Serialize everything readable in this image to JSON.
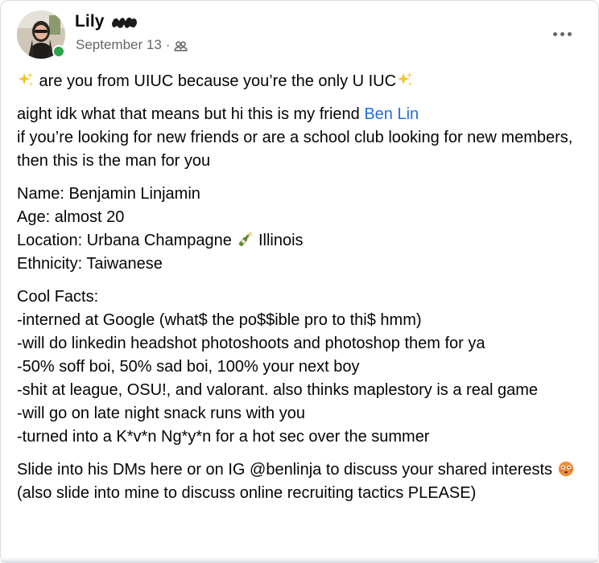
{
  "post": {
    "author": {
      "name": "Lily",
      "avatar_icon": "avatar-photo",
      "online": true,
      "online_color": "#31a24c"
    },
    "meta": {
      "date": "September 13",
      "separator": "·",
      "audience_icon": "friends-audience-icon"
    },
    "more_button": "more-options-icon",
    "text": {
      "line1_before": " are you from UIUC because you’re the only U  IUC",
      "line2_before": "aight idk what that means but hi this is my friend ",
      "mention": "Ben Lin",
      "line3": "if you’re looking for new friends or are a school club looking for new members, then this is the man for you",
      "name_line": "Name: Benjamin Linjamin",
      "age_line": "Age: almost 20",
      "location_before": "Location: Urbana Champagne ",
      "location_after": " Illinois",
      "ethnicity_line": "Ethnicity: Taiwanese",
      "cool_facts_heading": "Cool Facts:",
      "fact1": "-interned at Google (what$ the po$$ible pro to thi$ hmm)",
      "fact2": "-will do linkedin headshot photoshoots and photoshop them for ya",
      "fact3": "-50% soff boi, 50% sad boi, 100% your next boy",
      "fact4": "-shit at league, OSU!, and valorant. also thinks maplestory is a real game",
      "fact5": "-will go on late night snack runs with you",
      "fact6": "-turned into a K*v*n Ng*y*n for a hot sec over the summer",
      "closing1": "Slide into his DMs here or on IG @benlinja to discuss your shared interests ",
      "closing2": "(also slide into mine to discuss online recruiting tactics PLEASE)"
    },
    "colors": {
      "text": "#050505",
      "secondary": "#65676b",
      "link": "#216fdb"
    }
  }
}
